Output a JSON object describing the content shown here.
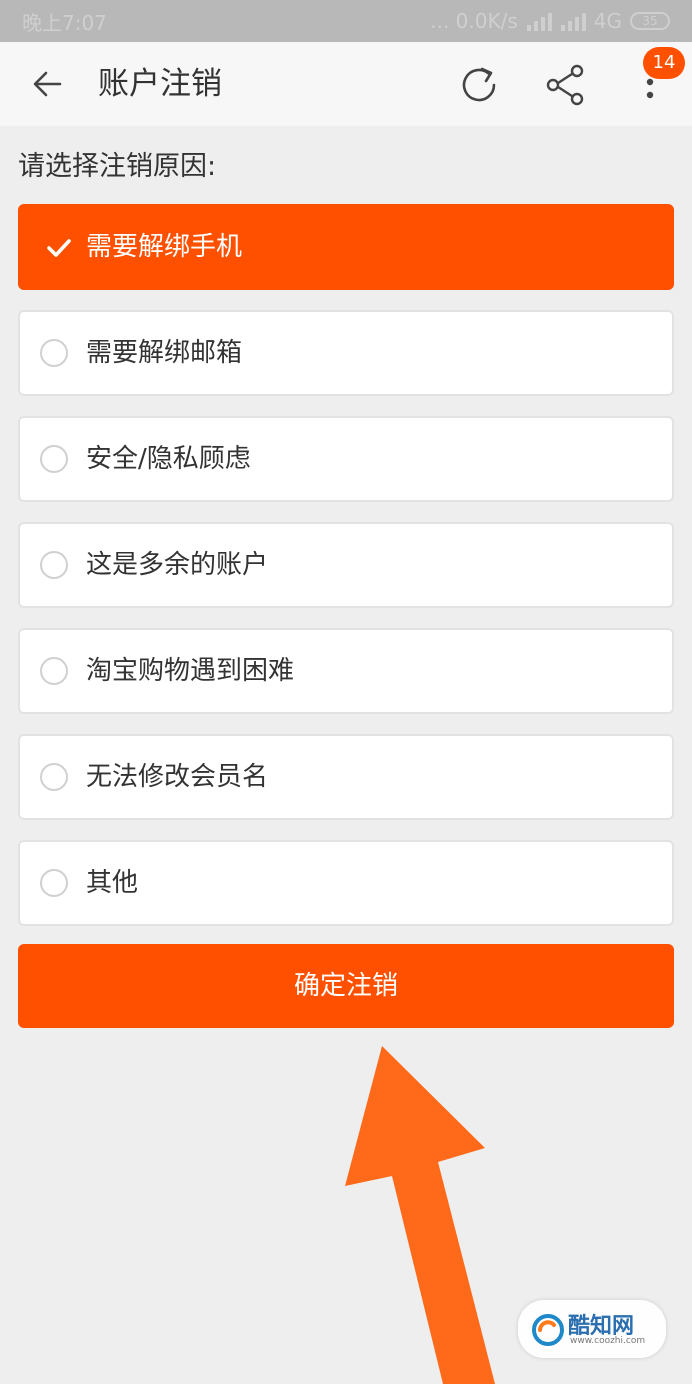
{
  "status_bar": {
    "time": "晚上7:07",
    "network": "... 0.0K/s",
    "signal_label": "4G",
    "battery": "35"
  },
  "header": {
    "title": "账户注销",
    "badge": "14",
    "back_icon": "arrow-left-icon",
    "refresh_icon": "refresh-icon",
    "share_icon": "share-icon",
    "more_icon": "more-vertical-icon"
  },
  "prompt": "请选择注销原因:",
  "options": [
    {
      "label": "需要解绑手机",
      "selected": true
    },
    {
      "label": "需要解绑邮箱",
      "selected": false
    },
    {
      "label": "安全/隐私顾虑",
      "selected": false
    },
    {
      "label": "这是多余的账户",
      "selected": false
    },
    {
      "label": "淘宝购物遇到困难",
      "selected": false
    },
    {
      "label": "无法修改会员名",
      "selected": false
    },
    {
      "label": "其他",
      "selected": false
    }
  ],
  "confirm_label": "确定注销",
  "watermark": {
    "brand": "酷知网",
    "site": "www.coozhi.com"
  },
  "colors": {
    "accent": "#ff5000",
    "annotation_arrow": "#ff6a1a"
  }
}
